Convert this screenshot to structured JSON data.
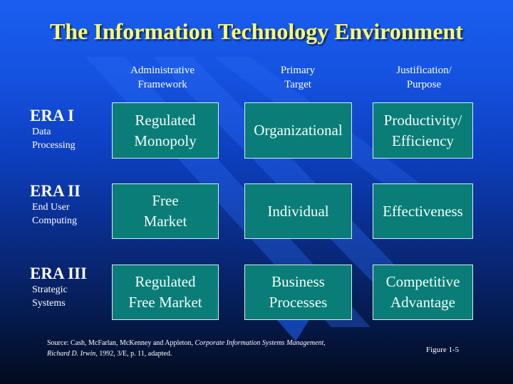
{
  "slide": {
    "title": "The Information Technology Environment",
    "columns": [
      {
        "line1": "Administrative",
        "line2": "Framework"
      },
      {
        "line1": "Primary",
        "line2": "Target"
      },
      {
        "line1": "Justification/",
        "line2": "Purpose"
      }
    ],
    "eras": [
      {
        "name": "ERA I",
        "desc1": "Data",
        "desc2": "Processing",
        "cells": [
          "Regulated\nMonopoly",
          "Organizational",
          "Productivity/\nEfficiency"
        ]
      },
      {
        "name": "ERA II",
        "desc1": "End User",
        "desc2": "Computing",
        "cells": [
          "Free\nMarket",
          "Individual",
          "Effectiveness"
        ]
      },
      {
        "name": "ERA III",
        "desc1": "Strategic",
        "desc2": "Systems",
        "cells": [
          "Regulated\nFree Market",
          "Business\nProcesses",
          "Competitive\nAdvantage"
        ]
      }
    ],
    "source": {
      "prefix": "Source: Cash, McFarlan, McKenney and Appleton, ",
      "book_title": "Corporate Information Systems Management,",
      "publisher": "Richard D. Irwin,",
      "suffix": " 1992, 3/E, p. 11, adapted."
    },
    "figure_label": "Figure 1-5"
  },
  "colors": {
    "title": "#ffff66",
    "box_fill": "#0a7d78",
    "box_border": "#d8eee8",
    "background_top": "#1a5ef0",
    "background_bottom": "#020a1c"
  }
}
